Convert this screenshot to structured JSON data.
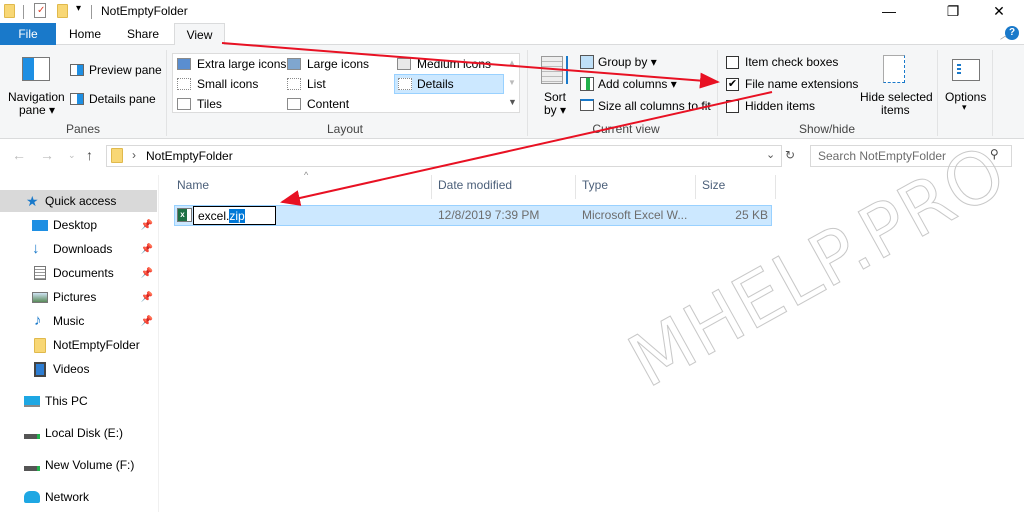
{
  "window": {
    "title": "NotEmptyFolder",
    "controls": {
      "minimize": "—",
      "maximize": "❐",
      "close": "✕"
    }
  },
  "ribbon_tabs": [
    {
      "label": "File"
    },
    {
      "label": "Home"
    },
    {
      "label": "Share"
    },
    {
      "label": "View",
      "active": true
    }
  ],
  "ribbon": {
    "panes": {
      "navigation_pane": "Navigation",
      "navigation_pane2": "pane ▾",
      "preview_pane": "Preview pane",
      "details_pane": "Details pane",
      "group_label": "Panes"
    },
    "layout": {
      "items": [
        "Extra large icons",
        "Large icons",
        "Medium icons",
        "Small icons",
        "List",
        "Details",
        "Tiles",
        "Content"
      ],
      "selected": "Details",
      "group_label": "Layout"
    },
    "current_view": {
      "sort_by": "Sort",
      "sort_by2": "by ▾",
      "group_by": "Group by ▾",
      "add_columns": "Add columns ▾",
      "size_all_columns": "Size all columns to fit",
      "group_label": "Current view"
    },
    "show_hide": {
      "item_check_boxes": {
        "label": "Item check boxes",
        "checked": false
      },
      "file_name_extensions": {
        "label": "File name extensions",
        "checked": true
      },
      "hidden_items": {
        "label": "Hidden items",
        "checked": false
      },
      "hide_selected": "Hide selected",
      "hide_selected2": "items",
      "group_label": "Show/hide"
    },
    "options": {
      "label": "Options",
      "caret": "▾"
    }
  },
  "address_bar": {
    "path": "NotEmptyFolder",
    "separator": "›",
    "search_placeholder": "Search NotEmptyFolder"
  },
  "nav_pane": {
    "items": [
      {
        "label": "Quick access",
        "icon": "star-icon",
        "selected": true
      },
      {
        "label": "Desktop",
        "icon": "desktop-icon",
        "pinned": true
      },
      {
        "label": "Downloads",
        "icon": "download-icon",
        "pinned": true
      },
      {
        "label": "Documents",
        "icon": "documents-icon",
        "pinned": true
      },
      {
        "label": "Pictures",
        "icon": "pictures-icon",
        "pinned": true
      },
      {
        "label": "Music",
        "icon": "music-icon",
        "pinned": true
      },
      {
        "label": "NotEmptyFolder",
        "icon": "folder-icon"
      },
      {
        "label": "Videos",
        "icon": "videos-icon"
      },
      {
        "label": "This PC",
        "icon": "pc-icon"
      },
      {
        "label": "Local Disk (E:)",
        "icon": "drive-icon"
      },
      {
        "label": "New Volume (F:)",
        "icon": "drive-icon"
      },
      {
        "label": "Network",
        "icon": "network-icon"
      }
    ]
  },
  "file_list": {
    "columns": [
      "Name",
      "Date modified",
      "Type",
      "Size"
    ],
    "rows": [
      {
        "name_base": "excel.",
        "name_ext": "zip",
        "date": "12/8/2019 7:39 PM",
        "type": "Microsoft Excel W...",
        "size": "25 KB",
        "selected": true,
        "renaming": true
      }
    ]
  },
  "watermark": "MHELP.PRO",
  "colors": {
    "accent": "#1979ca",
    "selection": "#cce8ff",
    "annotation_arrow": "#e81123"
  }
}
